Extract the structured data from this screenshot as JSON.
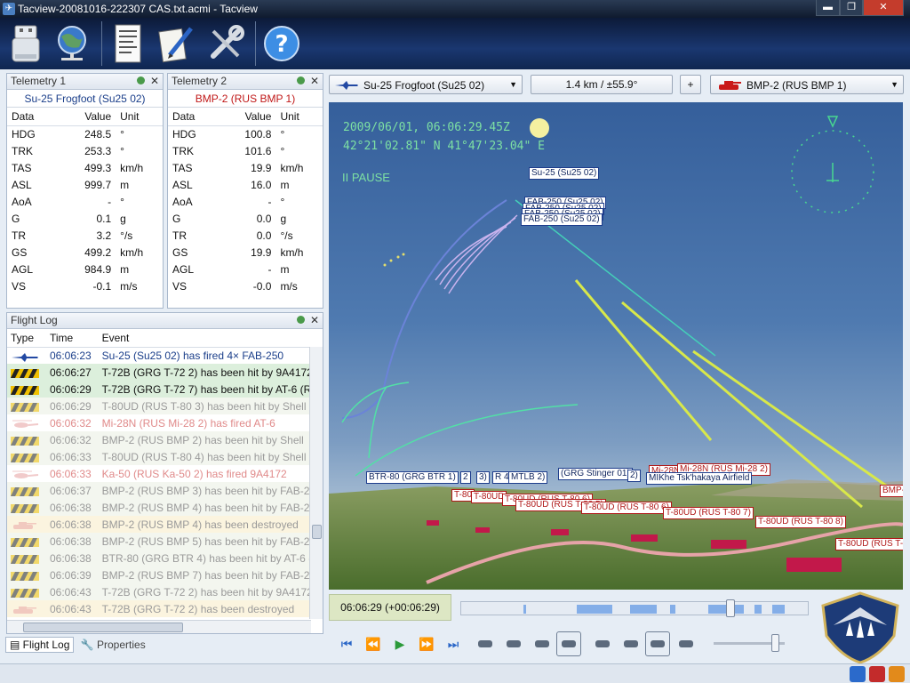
{
  "window": {
    "title": "Tacview-20081016-222307 CAS.txt.acmi - Tacview",
    "min": "▬",
    "max": "❐",
    "close": "✕"
  },
  "toolbar": {
    "icons": [
      "usb-drive-icon",
      "globe-network-icon",
      "document-icon",
      "notepad-pen-icon",
      "tools-wrench-icon",
      "help-icon"
    ],
    "help": "?"
  },
  "telemetry1": {
    "title": "Telemetry 1",
    "object": "Su-25 Frogfoot (Su25 02)",
    "color": "#1a3e8a",
    "columns": [
      "Data",
      "Value",
      "Unit"
    ],
    "rows": [
      [
        "HDG",
        "248.5",
        "°"
      ],
      [
        "TRK",
        "253.3",
        "°"
      ],
      [
        "TAS",
        "499.3",
        "km/h"
      ],
      [
        "ASL",
        "999.7",
        "m"
      ],
      [
        "AoA",
        "-",
        "°"
      ],
      [
        "G",
        "0.1",
        "g"
      ],
      [
        "TR",
        "3.2",
        "°/s"
      ],
      [
        "GS",
        "499.2",
        "km/h"
      ],
      [
        "AGL",
        "984.9",
        "m"
      ],
      [
        "VS",
        "-0.1",
        "m/s"
      ]
    ]
  },
  "telemetry2": {
    "title": "Telemetry 2",
    "object": "BMP-2 (RUS BMP 1)",
    "color": "#c01818",
    "columns": [
      "Data",
      "Value",
      "Unit"
    ],
    "rows": [
      [
        "HDG",
        "100.8",
        "°"
      ],
      [
        "TRK",
        "101.6",
        "°"
      ],
      [
        "TAS",
        "19.9",
        "km/h"
      ],
      [
        "ASL",
        "16.0",
        "m"
      ],
      [
        "AoA",
        "-",
        "°"
      ],
      [
        "G",
        "0.0",
        "g"
      ],
      [
        "TR",
        "0.0",
        "°/s"
      ],
      [
        "GS",
        "19.9",
        "km/h"
      ],
      [
        "AGL",
        "-",
        "m"
      ],
      [
        "VS",
        "-0.0",
        "m/s"
      ]
    ]
  },
  "flightlog": {
    "title": "Flight Log",
    "columns": [
      "Type",
      "Time",
      "Event"
    ],
    "rows": [
      {
        "time": "06:06:23",
        "event": "Su-25 (Su25 02) has fired 4× FAB-250",
        "bg": "#ffffff",
        "fg": "#1a3e8a",
        "icon": "jet-icon"
      },
      {
        "time": "06:06:27",
        "event": "T-72B (GRG T-72 2) has been hit by 9A4172 (R",
        "bg": "#dcefdc",
        "fg": "#111111",
        "icon": "hit-stripes-icon"
      },
      {
        "time": "06:06:29",
        "event": "T-72B (GRG T-72 7) has been hit by AT-6 (RU",
        "bg": "#dcefdc",
        "fg": "#111111",
        "icon": "hit-stripes-icon"
      },
      {
        "time": "06:06:29",
        "event": "T-80UD (RUS T-80 3) has been hit by Shell",
        "bg": "#f3f6ef",
        "fg": "#9a9a9a",
        "icon": "hit-stripes-icon"
      },
      {
        "time": "06:06:32",
        "event": "Mi-28N (RUS Mi-28 2) has fired AT-6",
        "bg": "#ffffff",
        "fg": "#e08a8a",
        "icon": "helicopter-icon"
      },
      {
        "time": "06:06:32",
        "event": "BMP-2 (RUS BMP 2) has been hit by Shell",
        "bg": "#f3f6ef",
        "fg": "#9a9a9a",
        "icon": "hit-stripes-icon"
      },
      {
        "time": "06:06:33",
        "event": "T-80UD (RUS T-80 4) has been hit by Shell",
        "bg": "#f3f6ef",
        "fg": "#9a9a9a",
        "icon": "hit-stripes-icon"
      },
      {
        "time": "06:06:33",
        "event": "Ka-50 (RUS Ka-50 2) has fired 9A4172",
        "bg": "#ffffff",
        "fg": "#e08a8a",
        "icon": "helicopter-icon"
      },
      {
        "time": "06:06:37",
        "event": "BMP-2 (RUS BMP 3) has been hit by FAB-250",
        "bg": "#f3f6ef",
        "fg": "#9a9a9a",
        "icon": "hit-stripes-icon"
      },
      {
        "time": "06:06:38",
        "event": "BMP-2 (RUS BMP 4) has been hit by FAB-250",
        "bg": "#f3f6ef",
        "fg": "#9a9a9a",
        "icon": "hit-stripes-icon"
      },
      {
        "time": "06:06:38",
        "event": "BMP-2 (RUS BMP 4) has been destroyed",
        "bg": "#fbf4df",
        "fg": "#9a9a9a",
        "icon": "tank-icon"
      },
      {
        "time": "06:06:38",
        "event": "BMP-2 (RUS BMP 5) has been hit by FAB-250",
        "bg": "#f3f6ef",
        "fg": "#9a9a9a",
        "icon": "hit-stripes-icon"
      },
      {
        "time": "06:06:38",
        "event": "BTR-80 (GRG BTR 4) has been hit by AT-6 (RU",
        "bg": "#f3f6ef",
        "fg": "#9a9a9a",
        "icon": "hit-stripes-icon"
      },
      {
        "time": "06:06:39",
        "event": "BMP-2 (RUS BMP 7) has been hit by FAB-250",
        "bg": "#f3f6ef",
        "fg": "#9a9a9a",
        "icon": "hit-stripes-icon"
      },
      {
        "time": "06:06:43",
        "event": "T-72B (GRG T-72 2) has been hit by 9A4172 (R",
        "bg": "#f3f6ef",
        "fg": "#9a9a9a",
        "icon": "hit-stripes-icon"
      },
      {
        "time": "06:06:43",
        "event": "T-72B (GRG T-72 2) has been destroyed",
        "bg": "#fbf4df",
        "fg": "#9a9a9a",
        "icon": "tank-icon"
      }
    ]
  },
  "tabs": {
    "flightlog": "Flight Log",
    "properties": "Properties"
  },
  "view": {
    "object1": "Su-25 Frogfoot (Su25 02)",
    "range": "1.4 km / ±55.9°",
    "plus": "+",
    "object2": "BMP-2 (RUS BMP 1)",
    "datetime": "2009/06/01, 06:06:29.45Z",
    "coords": "42°21'02.81\" N  41°47'23.04\" E",
    "pause": "II PAUSE",
    "labels": {
      "su25": "Su-25 (Su25 02)",
      "fab1": "FAB-250 (Su25 02)",
      "fab2": "FAB-250 (Su25 02)",
      "fab3": "FAB-250 (Su25 02)",
      "fab4": "FAB-250 (Su25 02)",
      "btr": "BTR-80 (GRG BTR 1)",
      "g2": "2",
      "g3": "3)",
      "g4": "R 4)",
      "mtlb": "MTLB 2)",
      "stinger": "(GRG Stinger 01)",
      "g5": "2)",
      "mi28a": "Mi-28N",
      "mi28b": "Mi-28N (RUS Mi-28 2)",
      "airfield": "MIKhe Tsk'hakaya Airfield",
      "t80a": "T-80",
      "t80b": "T-80UD",
      "t80c": "T-80UD (RUS T-80 6)",
      "t80d": "T-80UD (RUS T-80 5)",
      "t80e": "T-80UD (RUS T-80 6)",
      "t80f": "T-80UD (RUS T-80 7)",
      "t80g": "T-80UD (RUS T-80 8)",
      "t80h": "T-80UD (RUS T-8",
      "bmp": "BMP-"
    }
  },
  "timeline": {
    "time": "06:06:29 (+00:06:29)",
    "cursor_fraction": 0.78
  },
  "buttons": [
    "skip-start-icon",
    "rewind-icon",
    "play-icon",
    "fast-forward-icon",
    "skip-end-icon",
    "cockpit-view-icon",
    "aircraft-view-icon",
    "globe-view-icon",
    "binoculars-view-icon",
    "helicopter-filter-icon",
    "missile-filter-icon",
    "aircraft-filter-icon",
    "tank-filter-icon"
  ],
  "zoom_fraction": 0.92
}
